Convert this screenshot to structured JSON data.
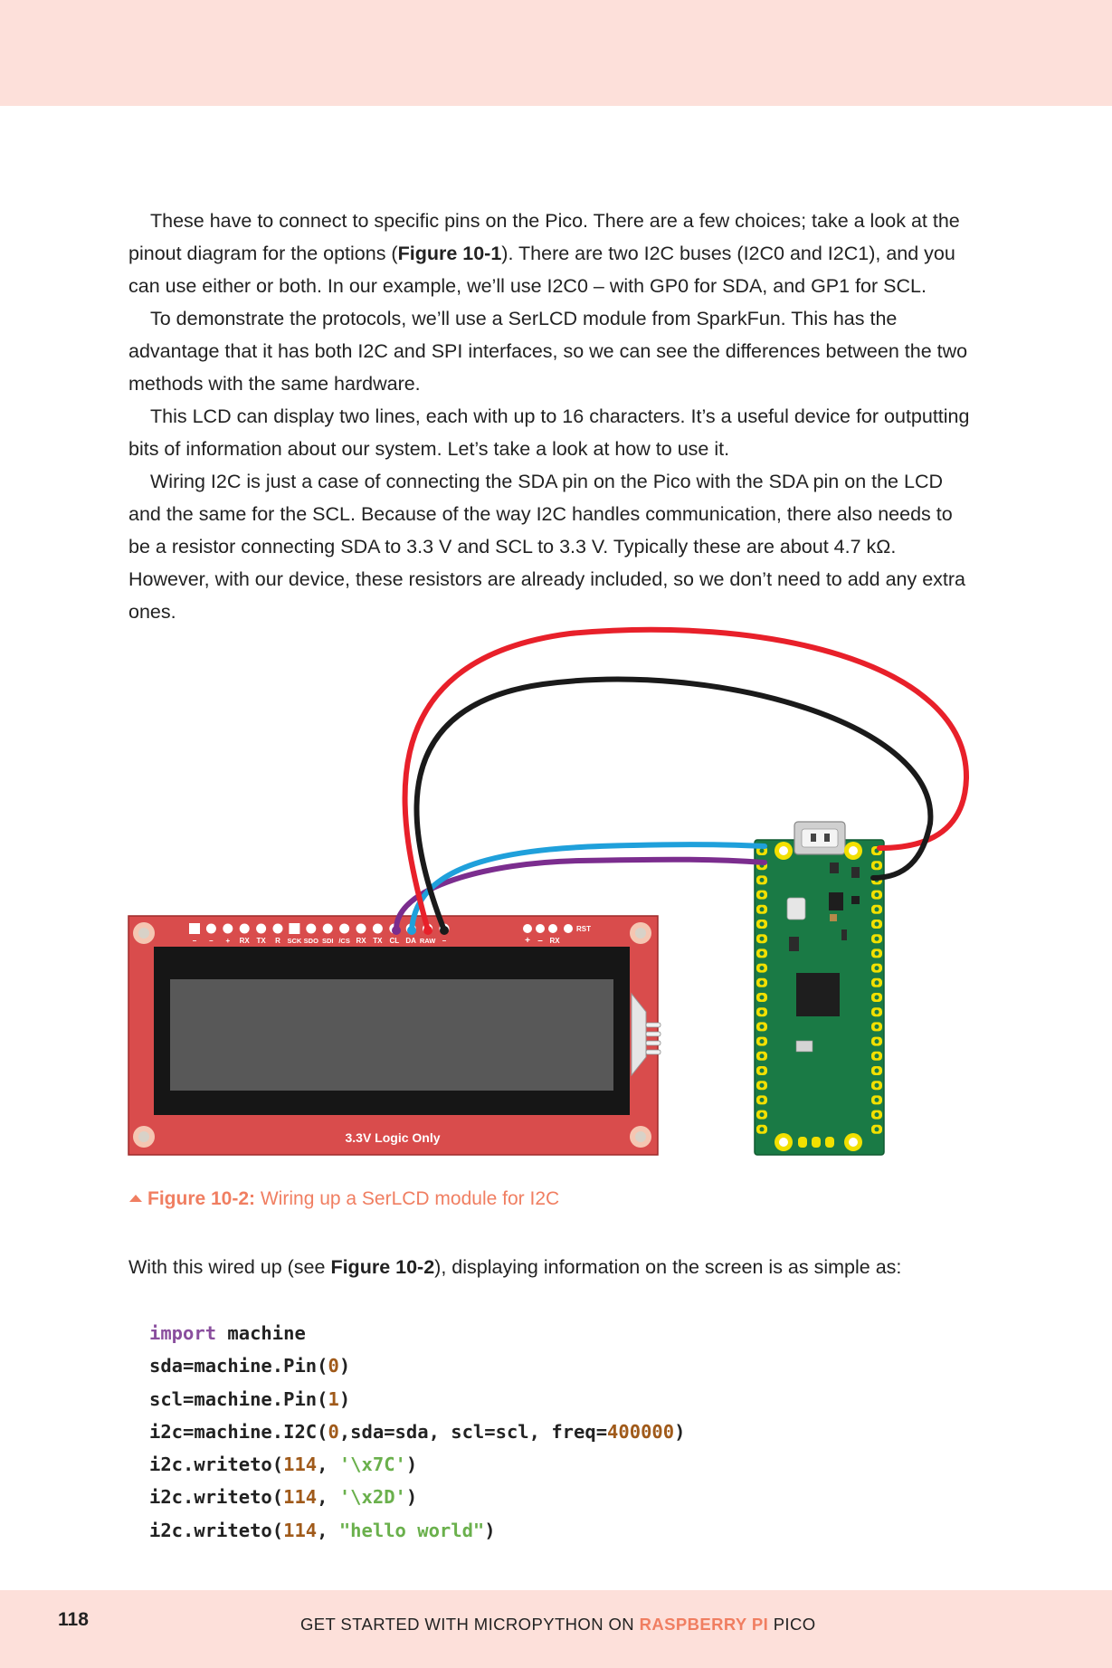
{
  "paragraphs": [
    {
      "pre": "These have to connect to specific pins on the Pico. There are a few choices; take a look at the pinout diagram for the options (",
      "ref": "Figure 10-1",
      "post": "). There are two I2C buses (I2C0 and I2C1), and you can use either or both. In our example, we’ll use I2C0 – with GP0 for SDA, and GP1 for SCL."
    },
    {
      "pre": "To demonstrate the protocols, we’ll use a SerLCD module from SparkFun. This has the advantage that it has both I2C and SPI interfaces, so we can see the differences between the two methods with the same hardware."
    },
    {
      "pre": "This LCD can display two lines, each with up to 16 characters. It’s a useful device for outputting bits of information about our system. Let’s take a look at how to use it."
    },
    {
      "pre": "Wiring I2C is just a case of connecting the SDA pin on the Pico with the SDA pin on the LCD and the same for the SCL. Because of the way I2C handles communication, there also needs to be a resistor connecting SDA to 3.3 V and SCL to 3.3 V. Typically these are about 4.7 kΩ. However, with our device, these resistors are already included, so we don’t need to add any extra ones."
    }
  ],
  "figure": {
    "lcd_pin_labels": [
      "–",
      "–",
      "+",
      "RX",
      "TX",
      "R",
      "SCK",
      "SDO",
      "SDI",
      "/CS",
      "RX",
      "TX",
      "CL",
      "DA",
      "RAW",
      "–"
    ],
    "lcd_right_labels": [
      "+",
      "–",
      "RX"
    ],
    "lcd_rst_label": "RST",
    "lcd_bottom_label": "3.3V Logic Only",
    "wire_colors": {
      "red": "#e8202a",
      "black": "#1a1a1a",
      "blue": "#1fa0db",
      "purple": "#7b2d8e"
    },
    "board_colors": {
      "lcd": "#d94c4c",
      "pico": "#1a7a45",
      "pad": "#f2e000"
    }
  },
  "caption": {
    "ref": "Figure 10-2:",
    "text": " Wiring up a SerLCD module for I2C"
  },
  "lead": {
    "pre": "With this wired up (see ",
    "ref": "Figure 10-2",
    "post": "), displaying information on the screen is as simple as:"
  },
  "code": {
    "l1": {
      "kw": "import",
      "rest": " machine"
    },
    "l2": {
      "a": "sda=machine.Pin(",
      "n": "0",
      "b": ")"
    },
    "l3": {
      "a": "scl=machine.Pin(",
      "n": "1",
      "b": ")"
    },
    "l4": {
      "a": "i2c=machine.I2C(",
      "n1": "0",
      "b": ",sda=sda, scl=scl, freq=",
      "n2": "400000",
      "c": ")"
    },
    "l5": {
      "a": "i2c.writeto(",
      "n": "114",
      "b": ", ",
      "s": "'\\x7C'",
      "c": ")"
    },
    "l6": {
      "a": "i2c.writeto(",
      "n": "114",
      "b": ", ",
      "s": "'\\x2D'",
      "c": ")"
    },
    "l7": {
      "a": "i2c.writeto(",
      "n": "114",
      "b": ", ",
      "s": "\"hello world\"",
      "c": ")"
    }
  },
  "footer": {
    "page_number": "118",
    "pre": "GET STARTED WITH MICROPYTHON ON ",
    "brand": "RASPBERRY PI",
    "post": " PICO"
  }
}
